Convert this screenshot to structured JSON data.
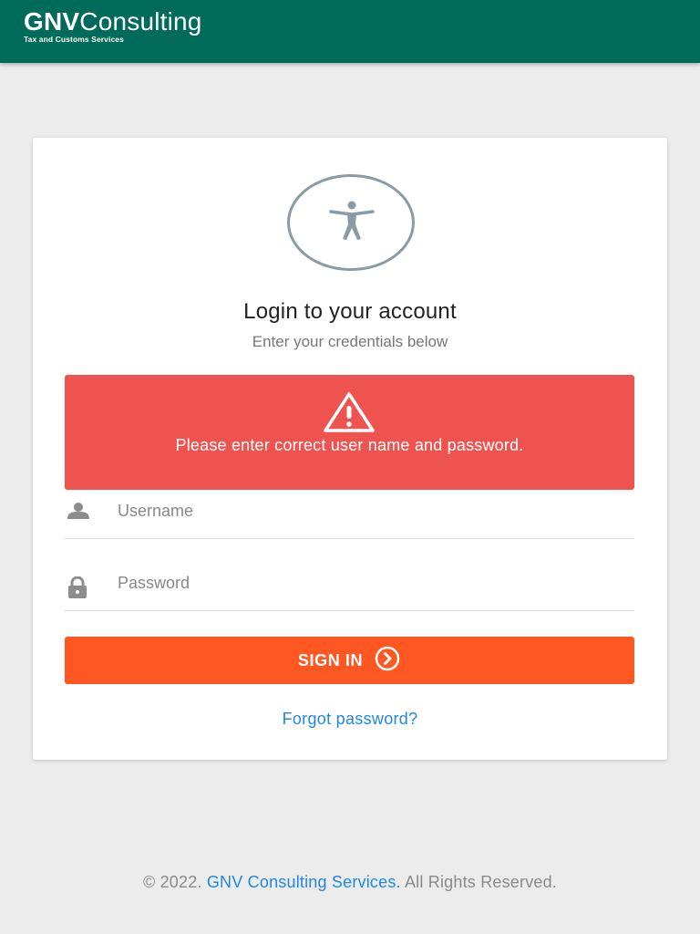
{
  "header": {
    "brand_bold": "GNV",
    "brand_light": "Consulting",
    "tagline": "Tax and Customs Services",
    "background": "#006b5a"
  },
  "login": {
    "avatar_icon": "accessibility-person-icon",
    "title": "Login to your account",
    "subtitle": "Enter your credentials below"
  },
  "alert": {
    "icon": "warning-triangle-icon",
    "message": "Please enter correct user name and password.",
    "color": "#ef5350"
  },
  "form": {
    "username": {
      "icon": "user-icon",
      "placeholder": "Username",
      "value": ""
    },
    "password": {
      "icon": "lock-icon",
      "placeholder": "Password",
      "value": ""
    },
    "signin_label": "SIGN IN",
    "signin_icon": "chevron-right-circle-icon",
    "signin_color": "#ff5722",
    "forgot_label": "Forgot password?"
  },
  "footer": {
    "prefix": "© 2022.",
    "link": "GNV Consulting Services.",
    "suffix": "All Rights Reserved."
  }
}
